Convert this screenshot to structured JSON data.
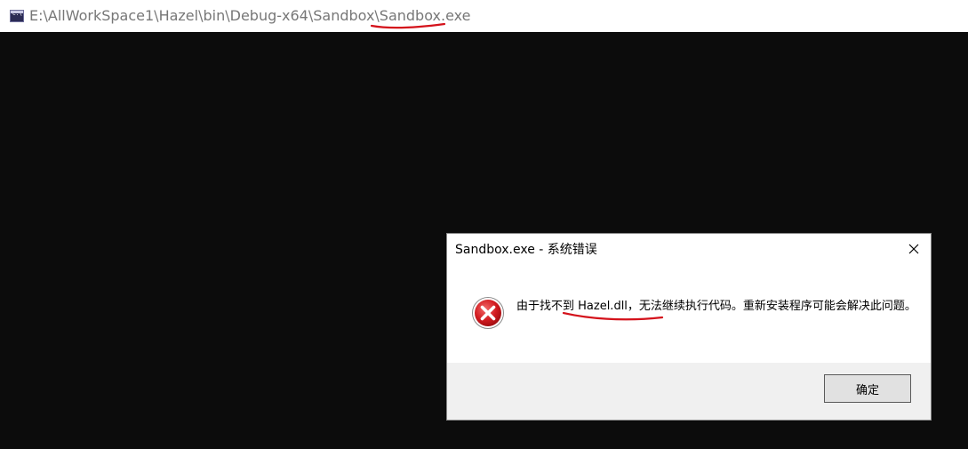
{
  "console": {
    "title": "E:\\AllWorkSpace1\\Hazel\\bin\\Debug-x64\\Sandbox\\Sandbox.exe",
    "icon_text": "C:\\",
    "icon": "console-app-icon"
  },
  "dialog": {
    "title": "Sandbox.exe - 系统错误",
    "message": "由于找不到 Hazel.dll，无法继续执行代码。重新安装程序可能会解决此问题。",
    "icon": "error-icon",
    "ok_label": "确定",
    "close_icon": "close-icon"
  },
  "colors": {
    "console_bg": "#0c0c0c",
    "annotation_red": "#d4121b",
    "error_red": "#d11a1f",
    "footer_bg": "#f0f0f0"
  }
}
